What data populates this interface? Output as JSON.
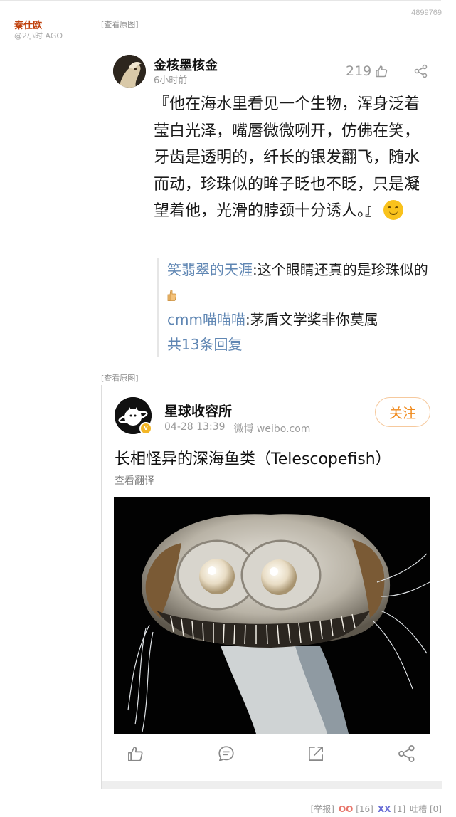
{
  "post": {
    "id": "4899769",
    "author": "秦仕欧",
    "time": "@2小时 AGO",
    "view_original_label": "[查看原图]"
  },
  "comment": {
    "user": "金核墨核金",
    "time": "6小时前",
    "likes": "219",
    "text": "『他在海水里看见一个生物，浑身泛着莹白光泽，嘴唇微微咧开，仿佛在笑，牙齿是透明的，纤长的银发翻飞，随水而动，珍珠似的眸子眨也不眨，只是凝望着他，光滑的脖颈十分诱人。』",
    "replies": [
      {
        "user": "笑翡翠的天涯",
        "text": ":这个眼睛还真的是珍珠似的"
      },
      {
        "user": "cmm喵喵喵",
        "text": ":茅盾文学奖非你莫属"
      }
    ],
    "more_replies": "共13条回复"
  },
  "weibo": {
    "user": "星球收容所",
    "date": "04-28 13:39",
    "source": "微博 weibo.com",
    "follow_label": "关注",
    "title": "长相怪异的深海鱼类（Telescopefish）",
    "translate_label": "查看翻译"
  },
  "footer": {
    "report": "[举报]",
    "oo_label": "OO",
    "oo_count": "[16]",
    "xx_label": "XX",
    "xx_count": "[1]",
    "tucao": "吐槽 [0]"
  },
  "icons": [
    "like-icon",
    "share-icon",
    "comment-icon",
    "repost-icon",
    "thumbs-up-icon",
    "smile-emoji-icon"
  ]
}
